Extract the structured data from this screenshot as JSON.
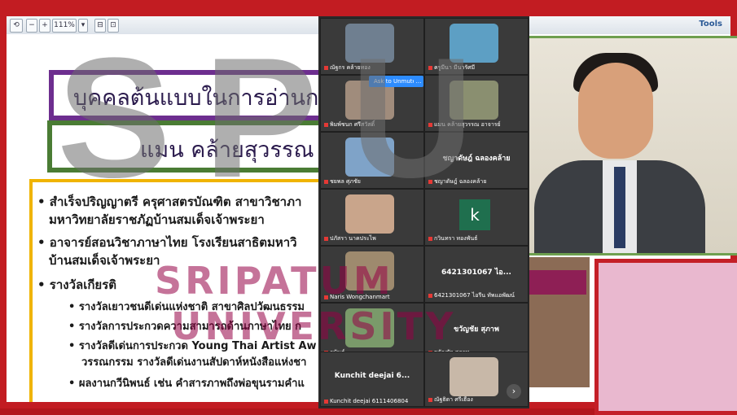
{
  "toolbar": {
    "zoom_value": "111%",
    "tools_label": "Tools"
  },
  "slide": {
    "title": "บุคคลต้นแบบในการอ่านกวี",
    "name": "แมน คล้ายสุวรรณ",
    "bullets": [
      "• สำเร็จปริญญาตรี ครุศาสตรบัณฑิต สาขาวิชาภา",
      "มหาวิทยาลัยราชภัฏบ้านสมเด็จเจ้าพระยา",
      "• อาจารย์สอนวิชาภาษาไทย โรงเรียนสาธิตมหาวิ",
      "บ้านสมเด็จเจ้าพระยา",
      "• รางวัลเกียรติ",
      "• รางวัลเยาวชนดีเด่นแห่งชาติ สาขาศิลปวัฒนธรรม",
      "• รางวัลการประกวดความสามารถด้านภาษาไทย ก",
      "• รางวัลดีเด่นการประกวด Young Thai Artist Aw",
      "วรรณกรรม รางวัลดีเด่นงานสัปดาห์หนังสือแห่งชา",
      "• ผลงานกวีนิพนธ์ เช่น คำสารภาพถึงพ่อขุนรามคำแ"
    ]
  },
  "zoom": {
    "unmute_label": "Ask to Unmute",
    "tiles": [
      {
        "name": "ณัฐกร คล้ายทอง",
        "big": ""
      },
      {
        "name": "ครูมีนา มีนารัศมี",
        "big": ""
      },
      {
        "name": "พิมพ์ชนก ศรีสวัสดิ์",
        "big": ""
      },
      {
        "name": "แมน คล้ายสุวรรณ อาจารย์",
        "big": ""
      },
      {
        "name": "ชยพล ศุภชัย",
        "big": ""
      },
      {
        "name": "ชญาดัษฎ์ ฉลองคล้าย",
        "big": "ชญาดัษฎ์ ฉลองคล้าย"
      },
      {
        "name": "ปภัสรา นาคประไพ",
        "big": ""
      },
      {
        "name": "กวินทรา ทองพันธ์",
        "big": ""
      },
      {
        "name": "Naris Wongchanmart",
        "big": ""
      },
      {
        "name": "6421301067 ไอรีน ทัพแอพัฒน์",
        "big": "6421301067 ไอ..."
      },
      {
        "name": "อนันต์",
        "big": ""
      },
      {
        "name": "ขวัญชัย สุภาพ",
        "big": "ขวัญชัย สุภาพ"
      },
      {
        "name": "Kunchit deejai 6111406804",
        "big": "Kunchit deejai 6..."
      },
      {
        "name": "ณัฐธิดา ศรีเฮือง",
        "big": ""
      }
    ],
    "k_letter": "k"
  },
  "watermark": {
    "logo": "SPU",
    "line1": "SRIPATUM",
    "line2": "UNIVERSITY"
  },
  "colors": {
    "frame": "#c21c22",
    "title_border": "#6d2e8f",
    "name_border": "#4a7c34",
    "content_border": "#f0b400",
    "zoom_bg": "#2b2b2b",
    "unmute": "#2d8cff"
  }
}
